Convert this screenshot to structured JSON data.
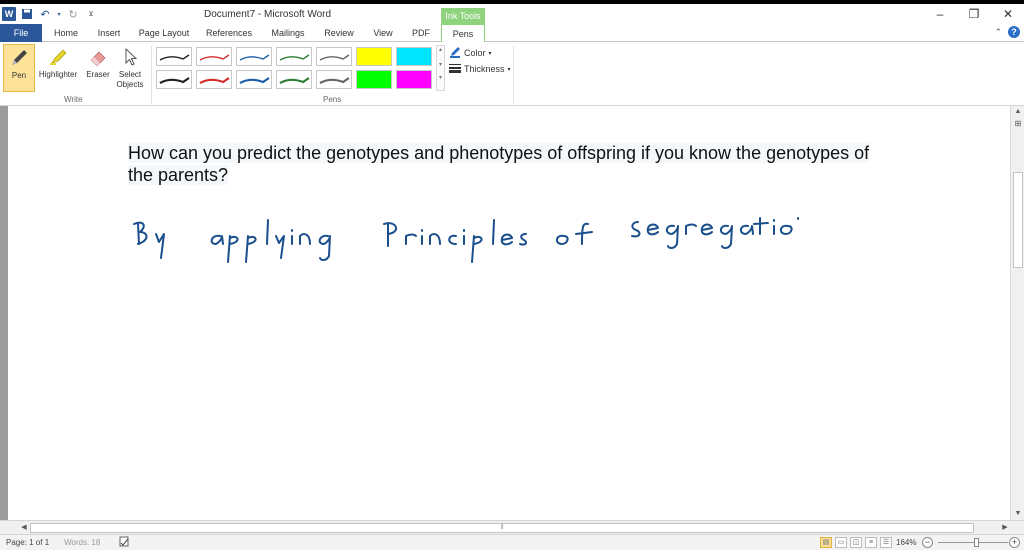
{
  "window": {
    "title": "Document7  -  Microsoft Word",
    "context_tab_group": "Ink Tools",
    "accent": "#2b579a",
    "ink_tools_color": "#8fd37f"
  },
  "tabs": [
    "File",
    "Home",
    "Insert",
    "Page Layout",
    "References",
    "Mailings",
    "Review",
    "View",
    "PDF",
    "Pens"
  ],
  "ribbon": {
    "write_tools": [
      {
        "label": "Pen",
        "icon": "pen-icon",
        "active": true
      },
      {
        "label": "Highlighter",
        "icon": "highlighter-icon"
      },
      {
        "label": "Eraser",
        "icon": "eraser-icon"
      },
      {
        "label": "Select\nObjects",
        "icon": "select-cursor-icon"
      }
    ],
    "write_group_label": "Write",
    "pens_group_label": "Pens",
    "color_label": "Color",
    "thickness_label": "Thickness",
    "pen_colors": [
      "#222222",
      "#d32f2f",
      "#1f5fa8",
      "#2e7d32",
      "#666666",
      "#ffff00",
      "#00e5ff",
      "#222222",
      "#d32f2f",
      "#1f5fa8",
      "#2e7d32",
      "#666666",
      "#00ff00",
      "#ff00ff"
    ]
  },
  "document": {
    "question": "How can you predict the genotypes and phenotypes of offspring if you know the genotypes of the parents?",
    "handwriting": "By applying Principles of segregatio",
    "ink_color": "#1a4f8c"
  },
  "status": {
    "page": "Page: 1 of 1",
    "words": "Words: 18",
    "zoom": "164%"
  }
}
